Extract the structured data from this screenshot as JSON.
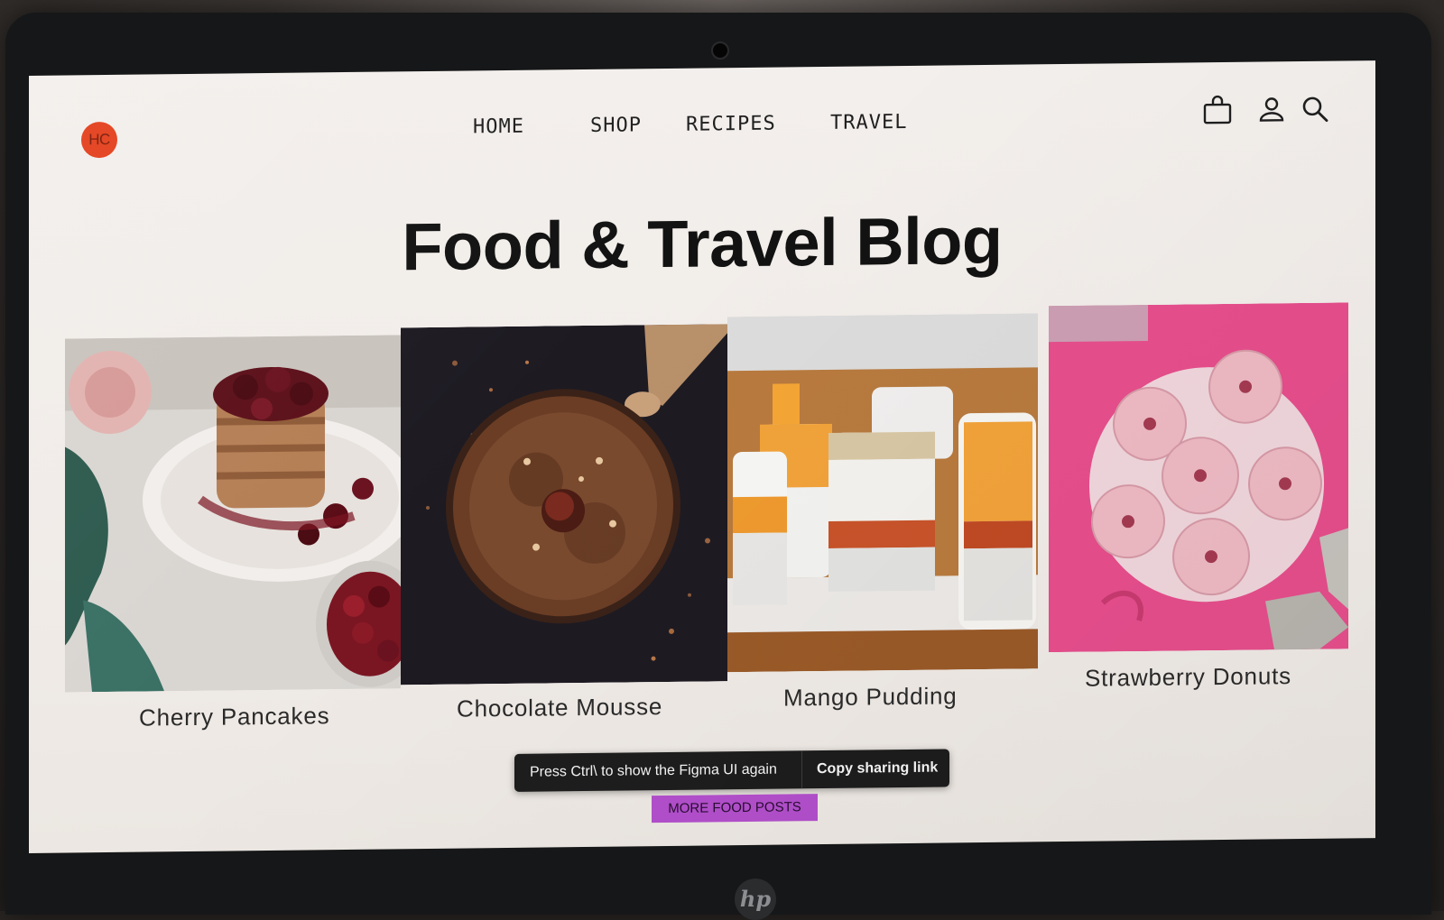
{
  "brand": {
    "logo_text": "HC",
    "accent": "#e4401c"
  },
  "nav": {
    "items": [
      {
        "label": "HOME"
      },
      {
        "label": "SHOP"
      },
      {
        "label": "RECIPES"
      },
      {
        "label": "TRAVEL"
      }
    ]
  },
  "header_icons": [
    "shopping-bag-icon",
    "user-icon",
    "search-icon"
  ],
  "hero": {
    "title": "Food & Travel Blog"
  },
  "posts": [
    {
      "title": "Cherry Pancakes",
      "image": "cherry-pancakes-photo"
    },
    {
      "title": "Chocolate Mousse",
      "image": "chocolate-mousse-photo"
    },
    {
      "title": "Mango Pudding",
      "image": "mango-pudding-photo"
    },
    {
      "title": "Strawberry Donuts",
      "image": "strawberry-donuts-photo"
    }
  ],
  "figma_toast": {
    "message": "Press Ctrl\\ to show the Figma UI again",
    "action": "Copy sharing link"
  },
  "more_button": {
    "label": "MORE FOOD POSTS",
    "color": "#b24fcb"
  },
  "device": {
    "logo": "hp"
  }
}
